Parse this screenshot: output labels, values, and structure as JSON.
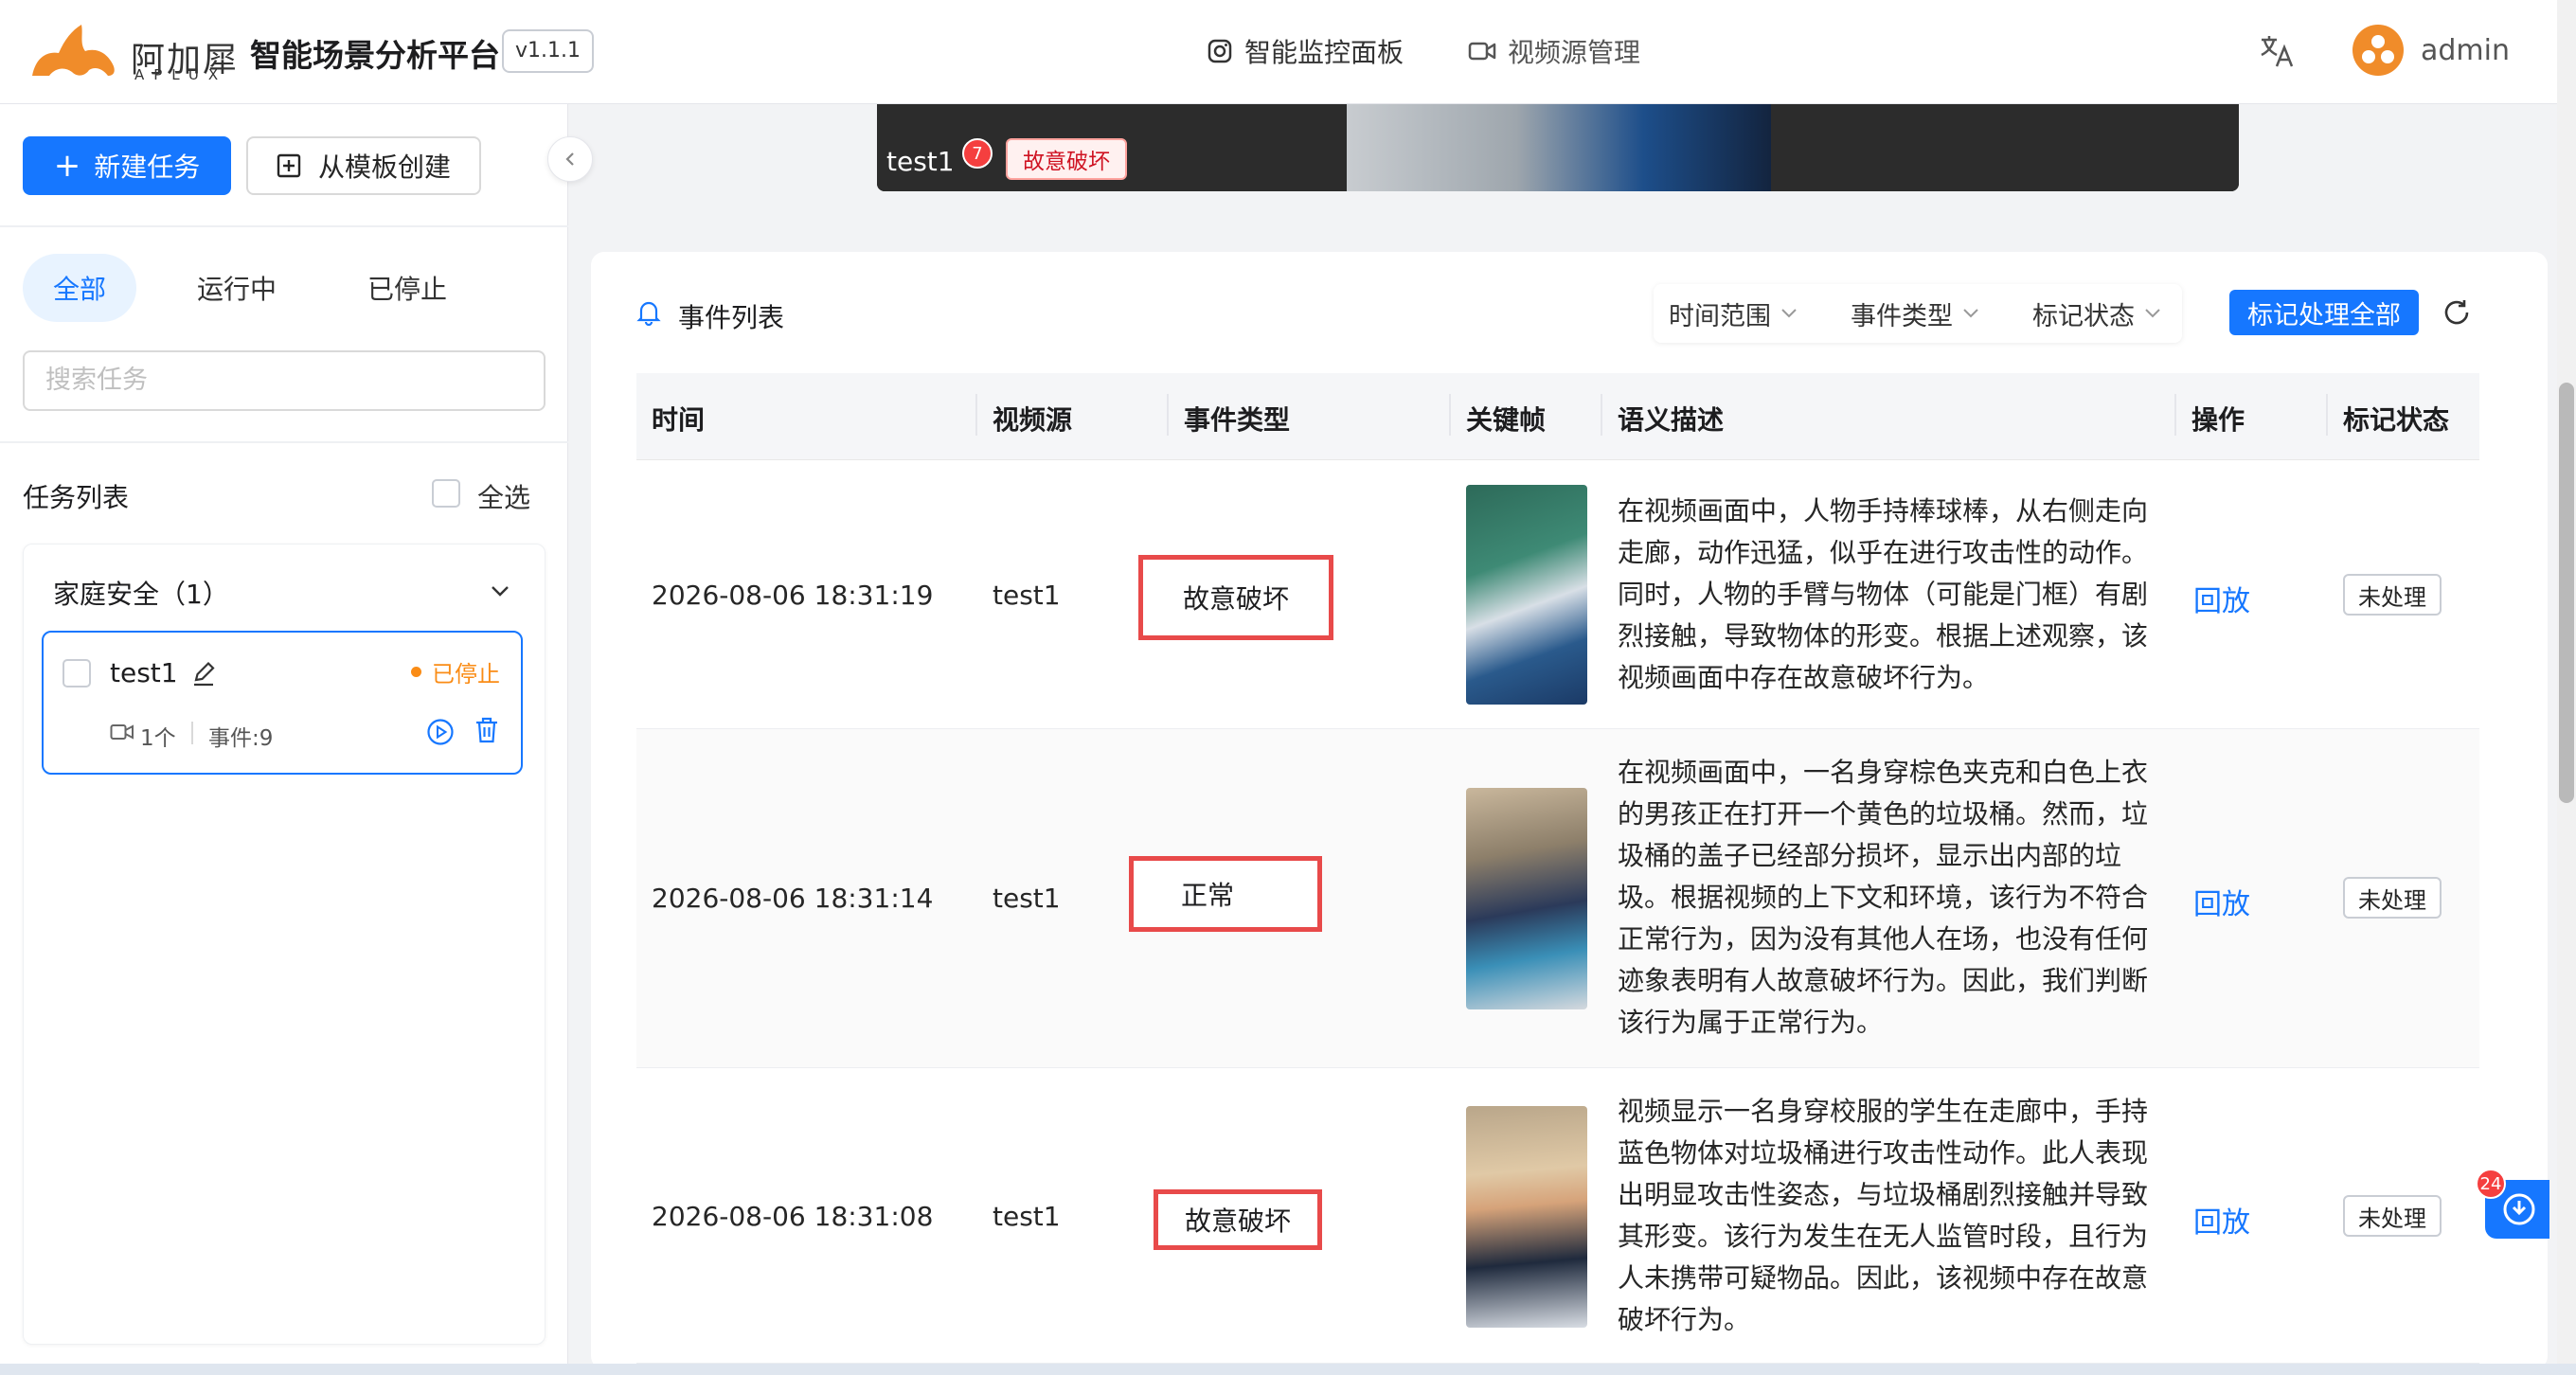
{
  "header": {
    "logo_cn": "阿加犀",
    "logo_en": "APLUX",
    "title": "智能场景分析平台",
    "version": "v1.1.1",
    "nav": [
      {
        "label": "智能监控面板",
        "icon": "camera-instagram-icon"
      },
      {
        "label": "视频源管理",
        "icon": "video-camera-icon"
      }
    ],
    "language_icon": "translate-icon",
    "user": "admin"
  },
  "sidebar": {
    "new_task_label": "新建任务",
    "from_template_label": "从模板创建",
    "segments": [
      "全部",
      "运行中",
      "已停止"
    ],
    "active_segment": "全部",
    "search_placeholder": "搜索任务",
    "task_list_title": "任务列表",
    "select_all_label": "全选",
    "group": {
      "name": "家庭安全（1）",
      "tasks": [
        {
          "name": "test1",
          "status": "已停止",
          "status_color": "#fa8c16",
          "video_count": "1个",
          "events": "事件:9"
        }
      ]
    }
  },
  "video_preview": {
    "source_name": "test1",
    "event_count": "7",
    "event_tag": "故意破坏"
  },
  "events": {
    "title": "事件列表",
    "filters": [
      "时间范围",
      "事件类型",
      "标记状态"
    ],
    "mark_all_label": "标记处理全部",
    "columns": [
      "时间",
      "视频源",
      "事件类型",
      "关键帧",
      "语义描述",
      "操作",
      "标记状态"
    ],
    "rows": [
      {
        "time": "2026-08-06 18:31:19",
        "source": "test1",
        "type": "故意破坏",
        "description": "在视频画面中，人物手持棒球棒，从右侧走向走廊，动作迅猛，似乎在进行攻击性的动作。同时，人物的手臂与物体（可能是门框）有剧烈接触，导致物体的形变。根据上述观察，该视频画面中存在故意破坏行为。",
        "action": "回放",
        "mark": "未处理"
      },
      {
        "time": "2026-08-06 18:31:14",
        "source": "test1",
        "type": "正常",
        "description": "在视频画面中，一名身穿棕色夹克和白色上衣的男孩正在打开一个黄色的垃圾桶。然而，垃圾桶的盖子已经部分损坏，显示出内部的垃圾。根据视频的上下文和环境，该行为不符合正常行为，因为没有其他人在场，也没有任何迹象表明有人故意破坏行为。因此，我们判断该行为属于正常行为。",
        "action": "回放",
        "mark": "未处理"
      },
      {
        "time": "2026-08-06 18:31:08",
        "source": "test1",
        "type": "故意破坏",
        "description": "视频显示一名身穿校服的学生在走廊中，手持蓝色物体对垃圾桶进行攻击性动作。此人表现出明显攻击性姿态，与垃圾桶剧烈接触并导致其形变。该行为发生在无人监管时段，且行为人未携带可疑物品。因此，该视频中存在故意破坏行为。",
        "action": "回放",
        "mark": "未处理"
      }
    ]
  },
  "help_badge": "24",
  "colors": {
    "primary": "#1677ff",
    "alert": "#e84a4a",
    "warning": "#fa8c16"
  }
}
